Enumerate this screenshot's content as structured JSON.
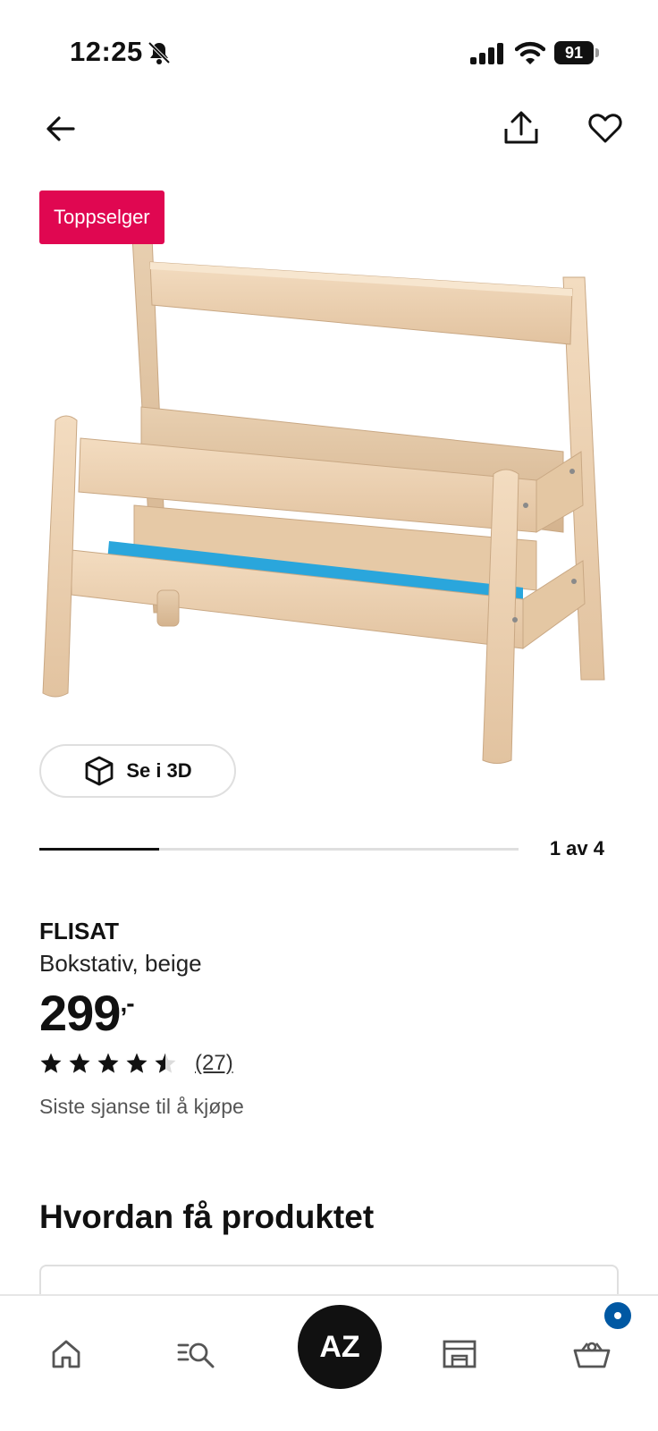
{
  "status_bar": {
    "time": "12:25",
    "battery": "91"
  },
  "header": {
    "back_icon": "arrow-left-icon",
    "share_icon": "share-icon",
    "favorite_icon": "heart-icon"
  },
  "product": {
    "badge": "Toppselger",
    "view_3d_label": "Se i 3D",
    "carousel": {
      "counter": "1 av 4",
      "current": 1,
      "total": 4
    },
    "name": "FLISAT",
    "description": "Bokstativ, beige",
    "price": "299",
    "price_suffix": ",-",
    "rating": {
      "value": 4.5,
      "max": 5,
      "review_count": "(27)"
    },
    "availability": "Siste sjanse til å kjøpe"
  },
  "section": {
    "title": "Hvordan få produktet"
  },
  "tab_bar": {
    "profile_initials": "AZ",
    "items": [
      "home-icon",
      "search-list-icon",
      "avatar",
      "store-icon",
      "cart-icon"
    ]
  },
  "colors": {
    "badge": "#e00751",
    "cart_badge": "#0058a3",
    "text": "#111111"
  }
}
